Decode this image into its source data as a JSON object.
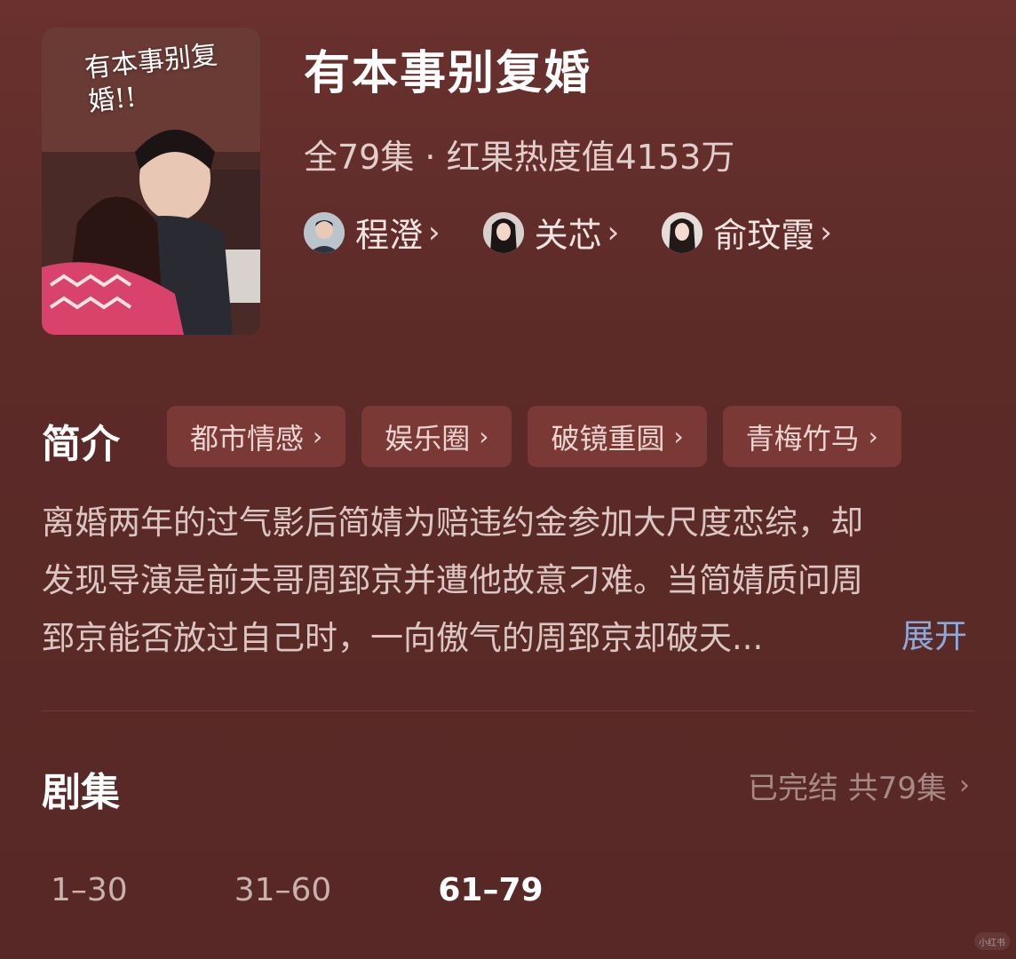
{
  "drama": {
    "title": "有本事别复婚",
    "meta": "全79集 · 红果热度值4153万",
    "poster_title": "有本事别复婚!!"
  },
  "cast": [
    {
      "name": "程澄"
    },
    {
      "name": "关芯"
    },
    {
      "name": "俞玟霞"
    }
  ],
  "intro": {
    "label": "简介",
    "tags": [
      "都市情感",
      "娱乐圈",
      "破镜重圆",
      "青梅竹马"
    ],
    "synopsis_lines": [
      "离婚两年的过气影后简婧为赔违约金参加大尺度恋综，却",
      "发现导演是前夫哥周郅京并遭他故意刁难。当简婧质问周",
      "郅京能否放过自己时，一向傲气的周郅京却破天..."
    ],
    "expand_label": "展开"
  },
  "episodes": {
    "label": "剧集",
    "status": "已完结 共79集",
    "ranges": [
      "1–30",
      "31–60",
      "61–79"
    ],
    "active_range": "61–79"
  },
  "watermark": "小红书",
  "colors": {
    "background": "#5c2b28",
    "tag_bg": "#7a3935",
    "expand_link": "#8ea9d8"
  },
  "icons": {
    "chevron": "chevron-right-icon"
  }
}
